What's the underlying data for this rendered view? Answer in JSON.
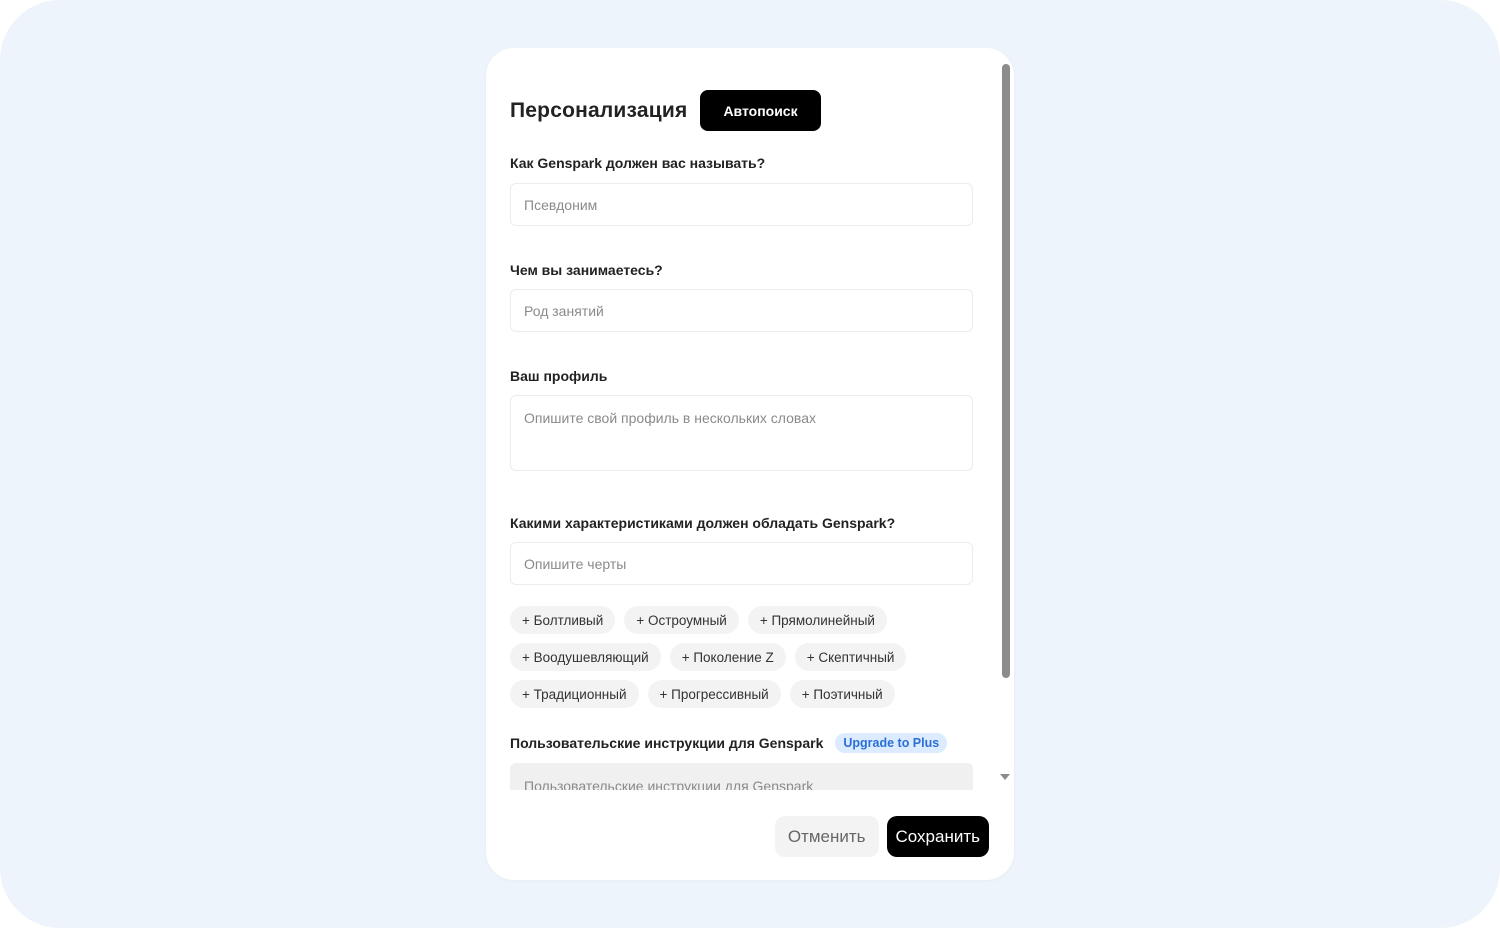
{
  "modal": {
    "title": "Персонализация",
    "autosearch_label": "Автопоиск"
  },
  "fields": {
    "nickname": {
      "label": "Как Genspark должен вас называть?",
      "placeholder": "Псевдоним",
      "value": ""
    },
    "occupation": {
      "label": "Чем вы занимаетесь?",
      "placeholder": "Род занятий",
      "value": ""
    },
    "profile": {
      "label": "Ваш профиль",
      "placeholder": "Опишите свой профиль в нескольких словах",
      "value": ""
    },
    "traits": {
      "label": "Какими характеристиками должен обладать Genspark?",
      "placeholder": "Опишите черты",
      "value": ""
    },
    "custom_instructions": {
      "label": "Пользовательские инструкции для Genspark",
      "badge": "Upgrade to Plus",
      "placeholder": "Пользовательские инструкции для Genspark"
    }
  },
  "trait_chips": [
    [
      "+ Болтливый",
      "+ Остроумный",
      "+ Прямолинейный"
    ],
    [
      "+ Воодушевляющий",
      "+ Поколение Z",
      "+ Скептичный"
    ],
    [
      "+ Традиционный",
      "+ Прогрессивный",
      "+ Поэтичный"
    ]
  ],
  "footer": {
    "cancel_label": "Отменить",
    "save_label": "Сохранить"
  },
  "colors": {
    "backdrop": "#eef4fb",
    "primary_button": "#000000",
    "badge_bg": "#dcebff",
    "badge_text": "#2b6fd6"
  }
}
